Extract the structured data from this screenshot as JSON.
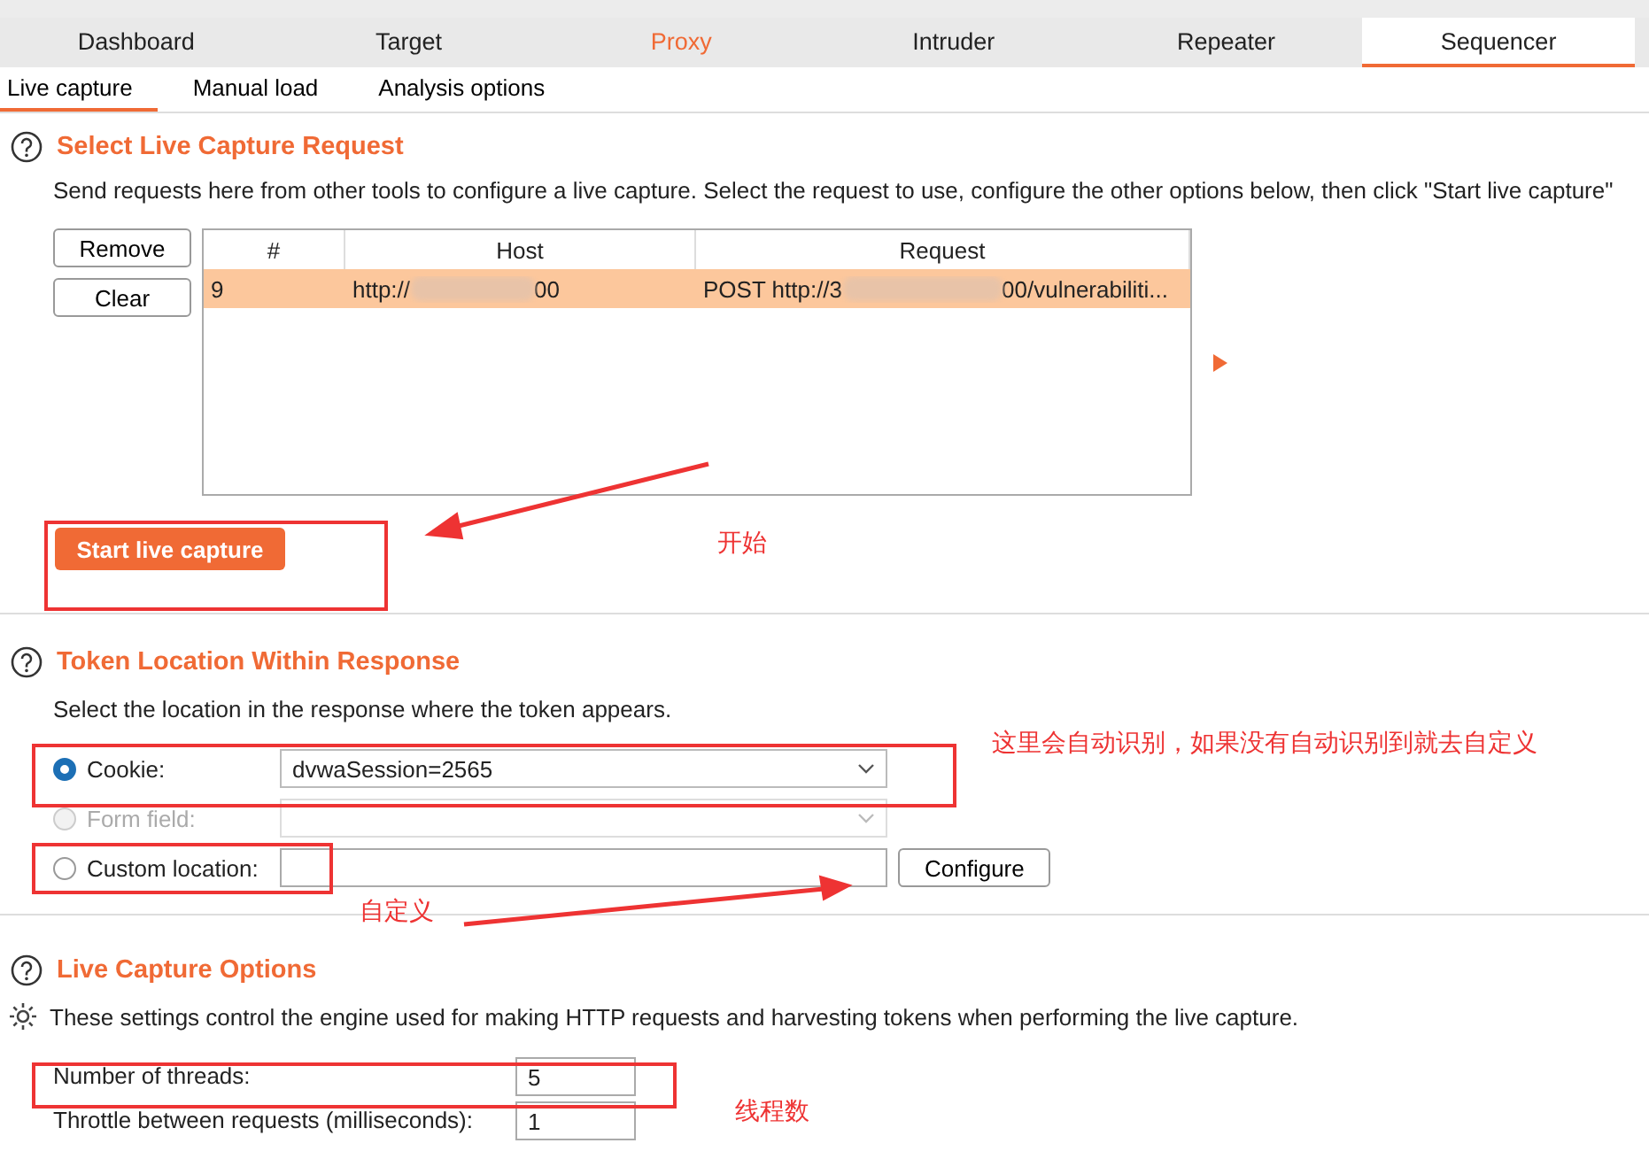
{
  "main_tabs": [
    {
      "label": "Dashboard",
      "selected": false,
      "highlighted": false
    },
    {
      "label": "Target",
      "selected": false,
      "highlighted": false
    },
    {
      "label": "Proxy",
      "selected": false,
      "highlighted": true
    },
    {
      "label": "Intruder",
      "selected": false,
      "highlighted": false
    },
    {
      "label": "Repeater",
      "selected": false,
      "highlighted": false
    },
    {
      "label": "Sequencer",
      "selected": true,
      "highlighted": false
    }
  ],
  "sub_tabs": [
    {
      "label": "Live capture",
      "selected": true
    },
    {
      "label": "Manual load",
      "selected": false
    },
    {
      "label": "Analysis options",
      "selected": false
    }
  ],
  "capture_request": {
    "title": "Select Live Capture Request",
    "description": "Send requests here from other tools to configure a live capture. Select the request to use, configure the other options below, then click \"Start live capture\"",
    "buttons": [
      "Remove",
      "Clear"
    ],
    "columns": [
      "#",
      "Host",
      "Request"
    ],
    "rows": [
      {
        "number": "9",
        "host_start": "http://",
        "host_end": "00",
        "request_start": "POST http://3",
        "request_end": "00/vulnerabiliti...",
        "selected": true
      }
    ],
    "start_button": "Start live capture"
  },
  "token_location": {
    "title": "Token Location Within Response",
    "description": "Select the location in the response where the token appears.",
    "options": [
      {
        "label": "Cookie:",
        "kind": "dropdown",
        "value": "dvwaSession=2565",
        "selected": true,
        "disabled": false
      },
      {
        "label": "Form field:",
        "kind": "dropdown",
        "selected": false,
        "disabled": true
      },
      {
        "label": "Custom location:",
        "kind": "text",
        "selected": false,
        "disabled": false,
        "button": "Configure"
      }
    ]
  },
  "capture_options": {
    "title": "Live Capture Options",
    "description": "These settings control the engine used for making HTTP requests and harvesting tokens when performing the live capture.",
    "fields": [
      {
        "label": "Number of threads:",
        "value": "5"
      },
      {
        "label": "Throttle between requests (milliseconds):",
        "value": "1"
      }
    ]
  },
  "annotations": [
    "开始",
    "这里会自动识别，如果没有自动识别到就去自定义",
    "自定义",
    "线程数"
  ]
}
